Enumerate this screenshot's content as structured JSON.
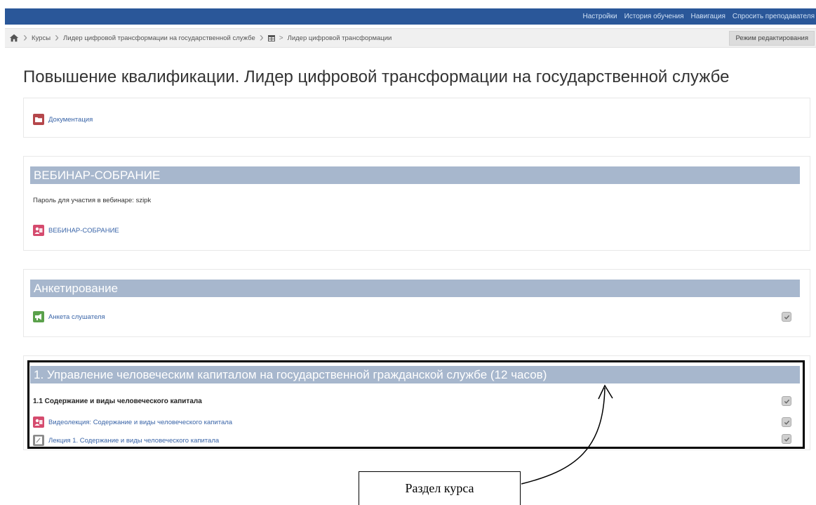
{
  "topnav": {
    "items": [
      "Настройки",
      "История обучения",
      "Навигация",
      "Спросить преподавателя"
    ]
  },
  "breadcrumb": {
    "courses": "Курсы",
    "category": "Лидер цифровой трансформации на государственной службе",
    "current": "Лидер цифровой трансформации"
  },
  "edit_mode_label": "Режим редактирования",
  "page_title": "Повышение квалификации. Лидер цифровой трансформации на государственной службе",
  "sections": {
    "docs": {
      "activity": "Документация"
    },
    "webinar": {
      "title": "ВЕБИНАР-СОБРАНИЕ",
      "password_text": "Пароль для участия в вебинаре: szipk",
      "activity": "ВЕБИНАР-СОБРАНИЕ"
    },
    "survey": {
      "title": "Анкетирование",
      "activity": "Анкета слушателя"
    },
    "section1": {
      "title": "1. Управление человеческим капиталом на государственной гражданской службе (12 часов)",
      "subheading": "1.1 Содержание и виды человеческого капитала",
      "activities": [
        "Видеолекция: Содержание и виды человеческого капитала",
        "Лекция 1. Содержание и виды человеческого капитала"
      ]
    }
  },
  "callout_label": "Раздел курса",
  "colors": {
    "topbar": "#2a5799",
    "section_header": "#a7b7cd",
    "link": "#3a65a8"
  }
}
